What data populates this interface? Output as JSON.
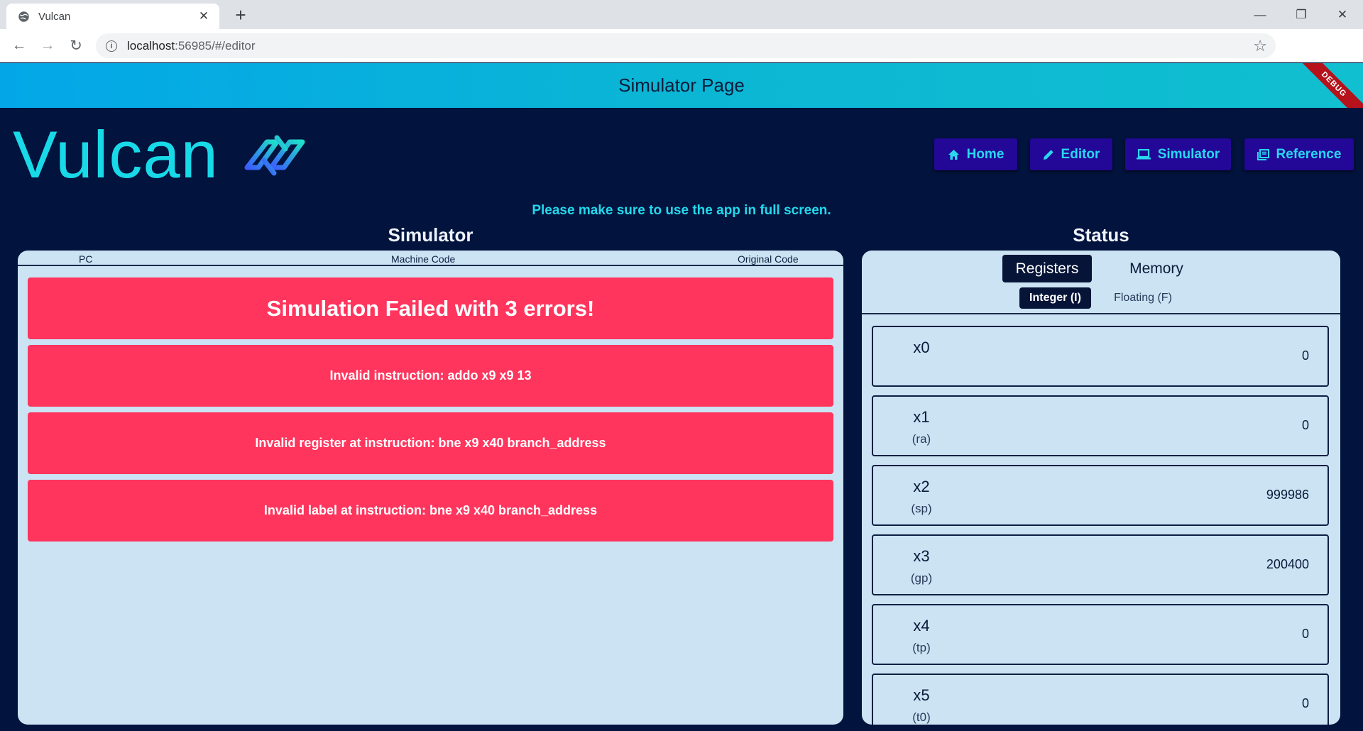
{
  "browser": {
    "tab_title": "Vulcan",
    "tab_close": "✕",
    "new_tab": "+",
    "url_host": "localhost",
    "url_rest": ":56985/#/editor",
    "window_controls": {
      "minimize": "—",
      "restore": "❐",
      "close": "✕"
    },
    "nav": {
      "back": "←",
      "forward": "→",
      "reload": "↻",
      "info": "i",
      "star": "☆",
      "menu": "⋮"
    }
  },
  "appbar": {
    "title": "Simulator Page",
    "debug_banner": "DEBUG"
  },
  "header": {
    "logo_text": "Vulcan",
    "nav": [
      {
        "label": "Home",
        "icon": "home-icon"
      },
      {
        "label": "Editor",
        "icon": "pencil-icon"
      },
      {
        "label": "Simulator",
        "icon": "laptop-icon"
      },
      {
        "label": "Reference",
        "icon": "book-icon"
      }
    ]
  },
  "notice": "Please make sure to use the app in full screen.",
  "simulator": {
    "title": "Simulator",
    "columns": {
      "pc": "PC",
      "machine_code": "Machine Code",
      "original_code": "Original Code"
    },
    "failure_title": "Simulation Failed with 3 errors!",
    "errors": [
      "Invalid instruction: addo x9 x9 13",
      "Invalid register at instruction: bne x9 x40 branch_address",
      "Invalid label at instruction: bne x9 x40 branch_address"
    ]
  },
  "status": {
    "title": "Status",
    "tabs": {
      "registers": "Registers",
      "memory": "Memory"
    },
    "subtabs": {
      "integer": "Integer (I)",
      "floating": "Floating (F)"
    },
    "registers": [
      {
        "name": "x0",
        "alias": "",
        "value": "0"
      },
      {
        "name": "x1",
        "alias": "(ra)",
        "value": "0"
      },
      {
        "name": "x2",
        "alias": "(sp)",
        "value": "999986"
      },
      {
        "name": "x3",
        "alias": "(gp)",
        "value": "200400"
      },
      {
        "name": "x4",
        "alias": "(tp)",
        "value": "0"
      },
      {
        "name": "x5",
        "alias": "(t0)",
        "value": "0"
      }
    ]
  },
  "colors": {
    "background": "#02133d",
    "accent": "#18d9e8",
    "nav_button": "#230796",
    "error": "#ff355d",
    "panel": "#cbe3f3"
  }
}
